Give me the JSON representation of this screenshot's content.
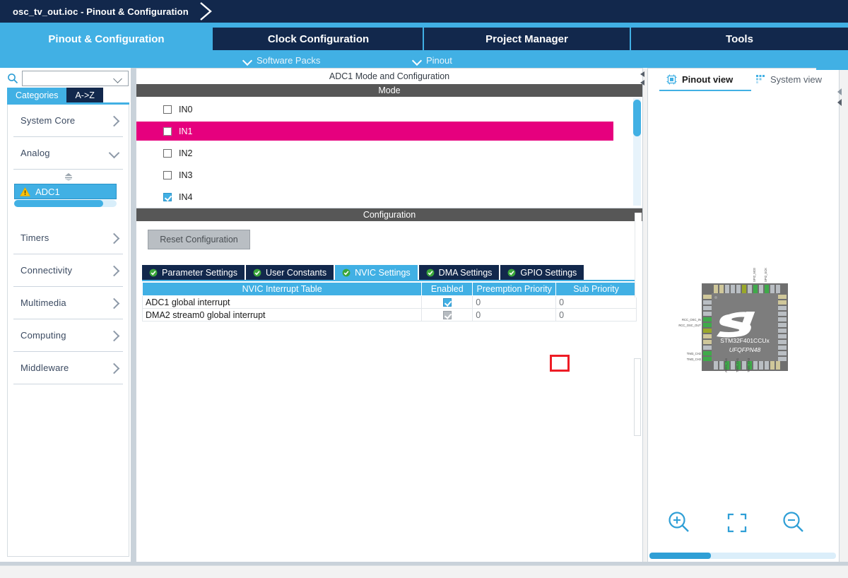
{
  "window": {
    "title": "osc_tv_out.ioc - Pinout & Configuration",
    "breadcrumb_arrow_icon": "chevron-right-breadcrumb-icon"
  },
  "main_tabs": [
    {
      "label": "Pinout & Configuration",
      "active": true
    },
    {
      "label": "Clock Configuration",
      "active": false
    },
    {
      "label": "Project Manager",
      "active": false
    },
    {
      "label": "Tools",
      "active": false
    }
  ],
  "submenu": [
    {
      "label": "Software Packs",
      "icon": "chevron-down-icon"
    },
    {
      "label": "Pinout",
      "icon": "chevron-down-icon"
    }
  ],
  "sidebar": {
    "search": {
      "placeholder": "",
      "value": "",
      "icon": "search-icon",
      "dropdown_icon": "chevron-down-icon"
    },
    "tabs": [
      {
        "label": "Categories",
        "selected": true
      },
      {
        "label": "A->Z",
        "selected": false
      }
    ],
    "categories": [
      {
        "label": "System Core",
        "expanded": false,
        "icon": "chevron-right-icon"
      },
      {
        "label": "Analog",
        "expanded": true,
        "icon": "chevron-down-icon"
      },
      {
        "label": "Timers",
        "expanded": false,
        "icon": "chevron-right-icon"
      },
      {
        "label": "Connectivity",
        "expanded": false,
        "icon": "chevron-right-icon"
      },
      {
        "label": "Multimedia",
        "expanded": false,
        "icon": "chevron-right-icon"
      },
      {
        "label": "Computing",
        "expanded": false,
        "icon": "chevron-right-icon"
      },
      {
        "label": "Middleware",
        "expanded": false,
        "icon": "chevron-right-icon"
      }
    ],
    "analog_items": [
      {
        "label": "ADC1",
        "selected": true,
        "icon": "warning-triangle-icon"
      }
    ]
  },
  "center": {
    "panel_title": "ADC1 Mode and Configuration",
    "mode_band": "Mode",
    "config_band": "Configuration",
    "mode_channels": [
      {
        "label": "IN0",
        "checked": false,
        "highlighted": false
      },
      {
        "label": "IN1",
        "checked": false,
        "highlighted": true
      },
      {
        "label": "IN2",
        "checked": false,
        "highlighted": false
      },
      {
        "label": "IN3",
        "checked": false,
        "highlighted": false
      },
      {
        "label": "IN4",
        "checked": true,
        "highlighted": false
      }
    ],
    "reset_button": "Reset Configuration",
    "config_tabs": [
      {
        "label": "Parameter Settings",
        "active": false,
        "icon": "green-check-icon"
      },
      {
        "label": "User Constants",
        "active": false,
        "icon": "green-check-icon"
      },
      {
        "label": "NVIC Settings",
        "active": true,
        "icon": "green-check-icon"
      },
      {
        "label": "DMA Settings",
        "active": false,
        "icon": "green-check-icon"
      },
      {
        "label": "GPIO Settings",
        "active": false,
        "icon": "green-check-icon"
      }
    ],
    "nvic_table": {
      "headers": [
        "NVIC Interrupt Table",
        "Enabled",
        "Preemption Priority",
        "Sub Priority"
      ],
      "rows": [
        {
          "name": "ADC1 global interrupt",
          "enabled": true,
          "enabled_disabled": false,
          "preemption": "0",
          "sub": "0"
        },
        {
          "name": "DMA2 stream0 global interrupt",
          "enabled": true,
          "enabled_disabled": true,
          "preemption": "0",
          "sub": "0"
        }
      ]
    }
  },
  "right": {
    "tabs": [
      {
        "label": "Pinout view",
        "active": true,
        "icon": "chip-grid-icon"
      },
      {
        "label": "System view",
        "active": false,
        "icon": "system-grid-icon"
      }
    ],
    "chip": {
      "part_number": "STM32F401CCUx",
      "package": "UFQFPN48",
      "logo": "st-logo-icon",
      "left_labels": [
        "RCC_OSC_IN",
        "RCC_OSC_OUT",
        "TIM3_CH2",
        "TIM3_CH3"
      ],
      "top_labels": [
        "SPI2_MOSI",
        "SPI2_SCK"
      ],
      "bottom_labels": [
        "ADC1_IN4",
        "TIM3_CH1",
        "TIM3_CH3"
      ]
    },
    "zoom_controls": [
      {
        "label": "",
        "icon": "zoom-in-icon"
      },
      {
        "label": "",
        "icon": "fit-to-screen-icon"
      },
      {
        "label": "",
        "icon": "zoom-out-icon"
      }
    ]
  },
  "colors": {
    "navy": "#12284c",
    "accent_blue": "#41b0e4",
    "pink_highlight": "#e6007e",
    "band_gray": "#575757",
    "red_annotation": "#ee1c25",
    "green_check": "#3aa63a"
  }
}
